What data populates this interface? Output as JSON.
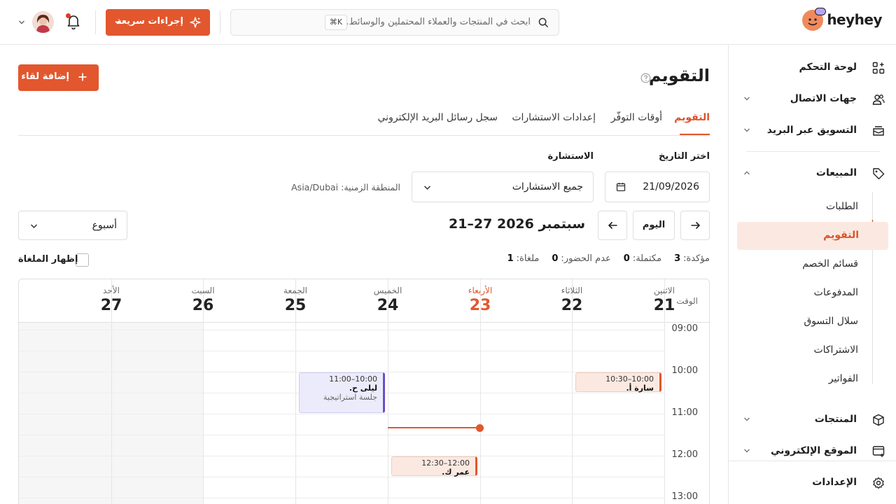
{
  "brand": {
    "name": "heyhey"
  },
  "search": {
    "placeholder": "ابحث في المنتجات والعملاء المحتملين والوسائط...",
    "shortcut": "⌘K"
  },
  "header": {
    "quick_actions_label": "إجراءات سريعة"
  },
  "colors": {
    "accent": "#e2572e",
    "accent_soft": "#fbe9e1",
    "violet_event": "#6a4fc7",
    "violet_bg": "#ecebfb"
  },
  "sidebar": {
    "items": [
      {
        "label": "لوحة التحكم",
        "icon": "dashboard-icon"
      },
      {
        "label": "جهات الاتصال",
        "icon": "contacts-icon"
      },
      {
        "label": "التسويق عبر البريد",
        "icon": "email-marketing-icon"
      },
      {
        "label": "المبيعات",
        "icon": "tag-icon"
      },
      {
        "label": "المنتجات",
        "icon": "box-icon"
      },
      {
        "label": "الموقع الإلكتروني",
        "icon": "website-icon"
      },
      {
        "label": "الإعدادات",
        "icon": "gear-icon"
      }
    ],
    "sales_sub": [
      "الطلبات",
      "التقويم",
      "قسائم الخصم",
      "المدفوعات",
      "سلال التسوق",
      "الاشتراكات",
      "الفواتير"
    ]
  },
  "page": {
    "title": "التقويم",
    "add_button": "إضافة لقاء",
    "tabs": [
      "التقويم",
      "أوقات التوفّر",
      "إعدادات الاستشارات",
      "سجل رسائل البريد الإلكتروني"
    ]
  },
  "filters": {
    "date_label": "اختر التاريخ",
    "date_value": "21/09/2026",
    "consult_label": "الاستشارة",
    "consult_value": "جميع الاستشارات",
    "timezone": "المنطقة الزمنية: Asia/Dubai"
  },
  "toolbar": {
    "today": "اليوم",
    "range": "21–27 سبتمبر 2026",
    "view": "أسبوع",
    "show_cancelled": "إظهار الملغاة"
  },
  "stats": [
    {
      "label": "مؤكدة:",
      "value": "3"
    },
    {
      "label": "مكتملة:",
      "value": "0"
    },
    {
      "label": "عدم الحضور:",
      "value": "0"
    },
    {
      "label": "ملغاة:",
      "value": "1"
    }
  ],
  "calendar": {
    "time_header": "الوقت",
    "days": [
      {
        "name": "الاثنين",
        "num": "21"
      },
      {
        "name": "الثلاثاء",
        "num": "22"
      },
      {
        "name": "الأربعاء",
        "num": "23"
      },
      {
        "name": "الخميس",
        "num": "24"
      },
      {
        "name": "الجمعة",
        "num": "25"
      },
      {
        "name": "السبت",
        "num": "26"
      },
      {
        "name": "الأحد",
        "num": "27"
      }
    ],
    "hours": [
      "09:00",
      "10:00",
      "11:00",
      "12:00",
      "13:00"
    ],
    "events": [
      {
        "time": "10:00–10:30",
        "name": "سارة أ.",
        "desc": ""
      },
      {
        "time": "10:00–11:00",
        "name": "ليلى ح.",
        "desc": "جلسة استراتيجية"
      },
      {
        "time": "12:00–12:30",
        "name": "عمر ك.",
        "desc": ""
      }
    ]
  }
}
